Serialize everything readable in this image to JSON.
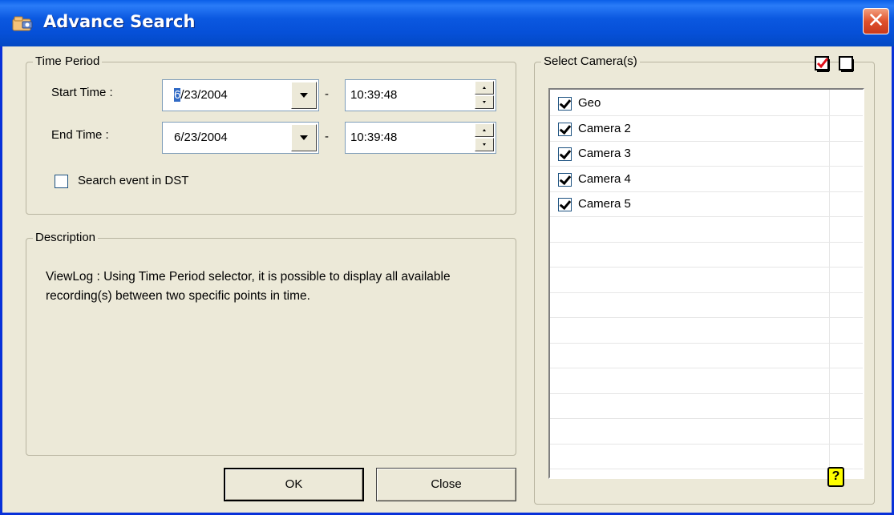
{
  "window": {
    "title": "Advance Search",
    "close_glyph": "✕"
  },
  "time_period": {
    "legend": "Time Period",
    "start_label": "Start Time :",
    "end_label": "End Time :",
    "start_date_caret": "6",
    "start_date_rest": "/23/2004",
    "start_time": "10:39:48",
    "end_date": "6/23/2004",
    "end_time": "10:39:48",
    "separator": "-",
    "dst_label": "Search event in DST",
    "dst_checked": false
  },
  "description": {
    "legend": "Description",
    "text": "ViewLog : Using Time Period selector, it is possible to display all available recording(s) between two specific points in time."
  },
  "cameras": {
    "legend": "Select Camera(s)",
    "items": [
      {
        "label": "Geo",
        "checked": true
      },
      {
        "label": "Camera 2",
        "checked": true
      },
      {
        "label": "Camera 3",
        "checked": true
      },
      {
        "label": "Camera 4",
        "checked": true
      },
      {
        "label": "Camera 5",
        "checked": true
      }
    ],
    "help_glyph": "?"
  },
  "buttons": {
    "ok": "OK",
    "close": "Close"
  },
  "icons": {
    "app": "folder-camera-icon",
    "select_all": "check-all-icon",
    "deselect_all": "uncheck-all-icon",
    "help": "help-icon"
  },
  "colors": {
    "titlebar": "#0b58e0",
    "close_button": "#e0512c",
    "dialog_bg": "#ece9d8",
    "help_bg": "#ffff00"
  }
}
